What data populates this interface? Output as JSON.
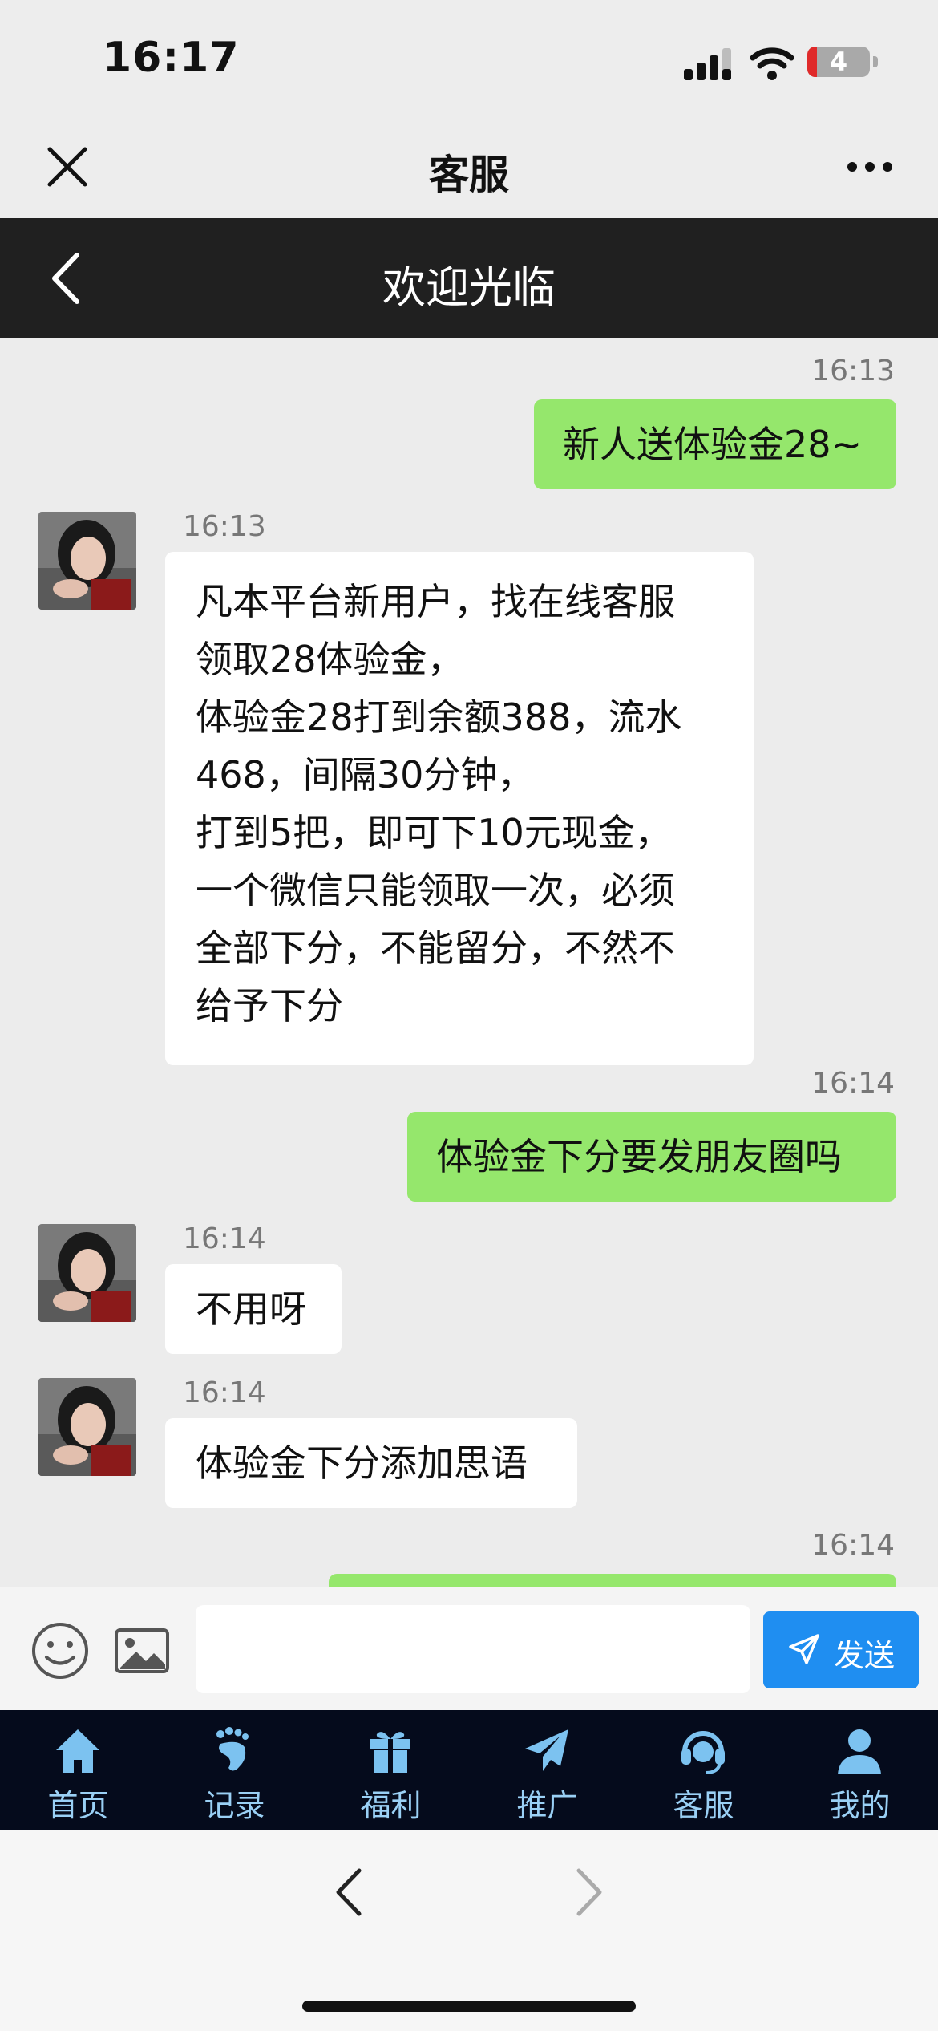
{
  "status_bar": {
    "time": "16:17",
    "battery_level": "4"
  },
  "wechat_header": {
    "title": "客服"
  },
  "page_header": {
    "title": "欢迎光临"
  },
  "messages": [
    {
      "side": "right",
      "time": "16:13",
      "lines": [
        "新人送体验金28~"
      ]
    },
    {
      "side": "left",
      "time": "16:13",
      "lines": [
        "凡本平台新用户，找在线客服",
        "领取28体验金，",
        "体验金28打到余额388，流水",
        "468，间隔30分钟，",
        "打到5把，即可下10元现金，",
        "一个微信只能领取一次，必须",
        "全部下分，不能留分，不然不",
        "给予下分"
      ]
    },
    {
      "side": "right",
      "time": "16:14",
      "lines": [
        "体验金下分要发朋友圈吗"
      ]
    },
    {
      "side": "left",
      "time": "16:14",
      "lines": [
        "不用呀"
      ]
    },
    {
      "side": "left",
      "time": "16:14",
      "lines": [
        "体验金下分添加思语"
      ]
    },
    {
      "side": "right",
      "time": "16:14",
      "lines": [
        ""
      ]
    }
  ],
  "input": {
    "value": "",
    "send_label": "发送"
  },
  "bottom_nav": [
    {
      "label": "首页",
      "icon": "home-icon"
    },
    {
      "label": "记录",
      "icon": "footprint-icon"
    },
    {
      "label": "福利",
      "icon": "gift-icon"
    },
    {
      "label": "推广",
      "icon": "paper-plane-icon"
    },
    {
      "label": "客服",
      "icon": "headset-icon"
    },
    {
      "label": "我的",
      "icon": "user-icon"
    }
  ],
  "colors": {
    "outgoing_bubble": "#95e76c",
    "incoming_bubble": "#ffffff",
    "send_button": "#1f8ef1",
    "nav_bg": "#050b1c",
    "nav_text": "#9ad0f5"
  }
}
